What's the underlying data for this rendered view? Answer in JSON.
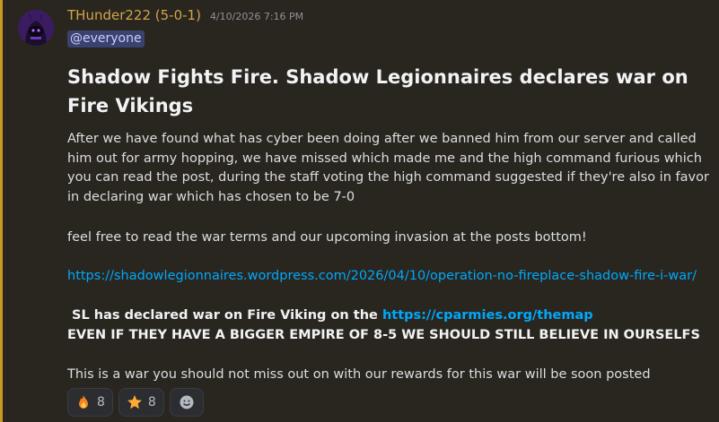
{
  "message": {
    "author": "THunder222 (5-0-1)",
    "timestamp": "4/10/2026 7:16 PM",
    "mention": "@everyone",
    "heading": "Shadow Fights Fire. Shadow Legionnaires declares war on Fire Vikings",
    "paragraph1": "After we have found what has cyber been doing after we banned him from our server and called him out for army hopping, we have missed which made me and the high command furious which you can read the post, during the staff voting the high command suggested if they're also in favor in declaring war which has chosen to be 7-0",
    "paragraph2": "feel free to read the war terms and our upcoming invasion at the posts bottom!",
    "link1": "https://shadowlegionnaires.wordpress.com/2026/04/10/operation-no-fireplace-shadow-fire-i-war/",
    "bold_line1_prefix": " SL has declared war on Fire Viking on the ",
    "bold_line1_link": "https://cparmies.org/themap",
    "bold_line2": "EVEN IF THEY HAVE A BIGGER EMPIRE OF 8-5 WE SHOULD STILL BELIEVE IN OURSELFS",
    "paragraph3": "This is a war you should not miss out on with our rewards for this war will be soon posted"
  },
  "reactions": [
    {
      "icon": "fire-icon",
      "count": "8"
    },
    {
      "icon": "star-icon",
      "count": "8"
    },
    {
      "icon": "add-reaction-icon",
      "count": ""
    }
  ],
  "colors": {
    "background": "#1a1a1e",
    "highlight": "#29261f",
    "highlight_border": "#c99a1d",
    "username": "#d2a34a",
    "link": "#00a8fc",
    "mention_bg": "#3c4270"
  }
}
